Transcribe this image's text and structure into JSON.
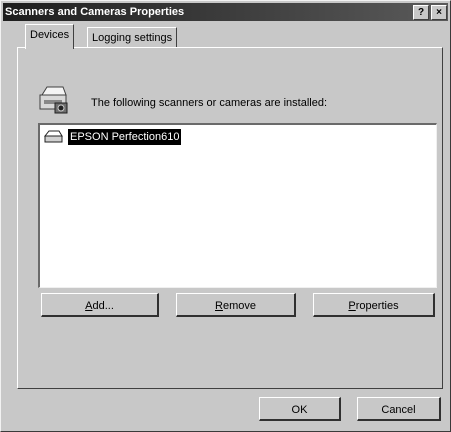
{
  "window": {
    "title": "Scanners and Cameras Properties"
  },
  "title_buttons": {
    "help": "?",
    "close": "×"
  },
  "tabs": [
    {
      "label": "Devices",
      "active": true
    },
    {
      "label": "Logging settings",
      "active": false
    }
  ],
  "devices": {
    "header_text": "The following scanners or cameras are installed:",
    "items": [
      {
        "name": "EPSON Perfection610",
        "selected": true
      }
    ],
    "buttons": {
      "add": {
        "mnemonic": "A",
        "rest": "dd..."
      },
      "remove": {
        "mnemonic": "R",
        "rest": "emove"
      },
      "properties": {
        "mnemonic": "P",
        "rest": "roperties"
      }
    }
  },
  "footer": {
    "ok_label": "OK",
    "cancel_label": "Cancel"
  },
  "icons": {
    "scanner": "scanner-icon",
    "device": "scanner-device-icon"
  },
  "colors": {
    "dialog_bg": "#c8c8c8",
    "titlebar": "#1e1e1e",
    "selection": "#000000"
  }
}
